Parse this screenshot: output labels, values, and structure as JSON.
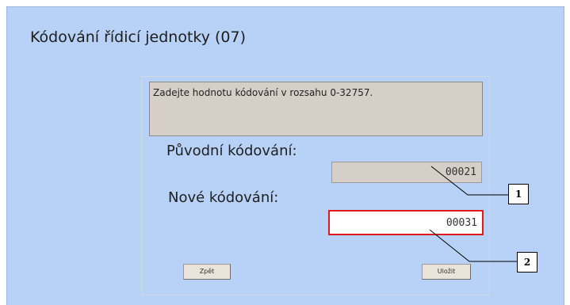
{
  "dialog": {
    "title": "Kódování řídicí jednotky (07)",
    "instruction": "Zadejte hodnotu kódování v rozsahu 0-32757.",
    "original_label": "Původní kódování:",
    "original_value": "00021",
    "new_label": "Nové kódování:",
    "new_value": "00031",
    "back_button": "Zpět",
    "save_button": "Uložit"
  },
  "callouts": [
    "1",
    "2"
  ],
  "colors": {
    "panel_bg": "#b7d2f6",
    "readonly_bg": "#d5cfc8",
    "highlight_border": "#e01a1a"
  }
}
